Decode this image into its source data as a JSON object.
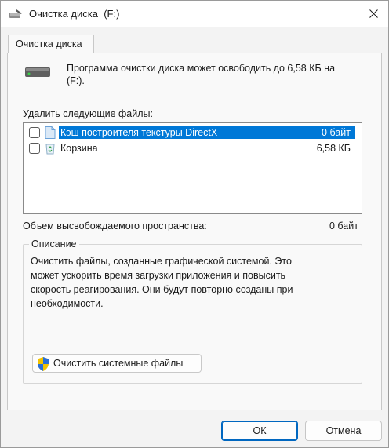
{
  "window": {
    "title": "Очистка диска  (F:)"
  },
  "tab": {
    "label": "Очистка диска"
  },
  "summary": {
    "line1": "Программа очистки диска может освободить до 6,58 КБ на",
    "line2": "(F:)."
  },
  "files_label": "Удалить следующие файлы:",
  "files": [
    {
      "name": "Кэш построителя текстуры DirectX",
      "size": "0 байт",
      "checked": false,
      "selected": true,
      "icon": "file-icon"
    },
    {
      "name": "Корзина",
      "size": "6,58 КБ",
      "checked": false,
      "selected": false,
      "icon": "recycle-bin-icon"
    }
  ],
  "freed": {
    "label": "Объем высвобождаемого пространства:",
    "value": "0 байт"
  },
  "description": {
    "legend": "Описание",
    "lines": [
      "Очистить файлы, созданные графической системой. Это",
      "может ускорить время загрузки приложения и повысить",
      "скорость реагирования. Они будут повторно созданы при",
      "необходимости."
    ]
  },
  "cleanup_system_button": "Очистить системные файлы",
  "buttons": {
    "ok": "ОК",
    "cancel": "Отмена"
  },
  "colors": {
    "selection": "#0078d7",
    "primary_border": "#0067c0"
  }
}
